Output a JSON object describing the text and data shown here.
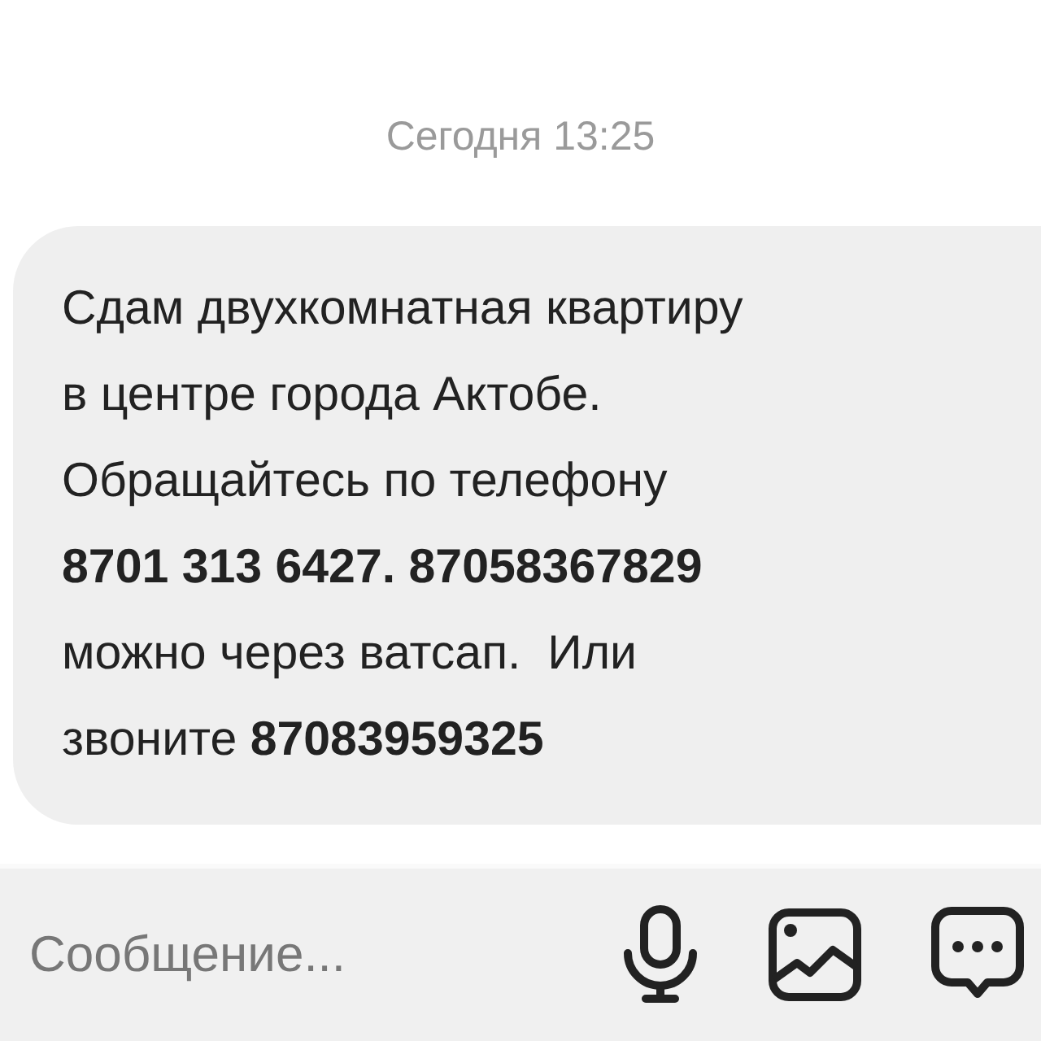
{
  "date_header": "Сегодня 13:25",
  "messages": [
    {
      "kind": "incoming",
      "text": "Сдам двухкомнатная квартиру\nв центре города Актобе.\nОбращайтесь по телефону\n**8701 313 6427. 87058367829**\nможно через ватсап.  Или\nзвоните **87083959325**"
    }
  ],
  "composer": {
    "placeholder": "Сообщение..."
  }
}
